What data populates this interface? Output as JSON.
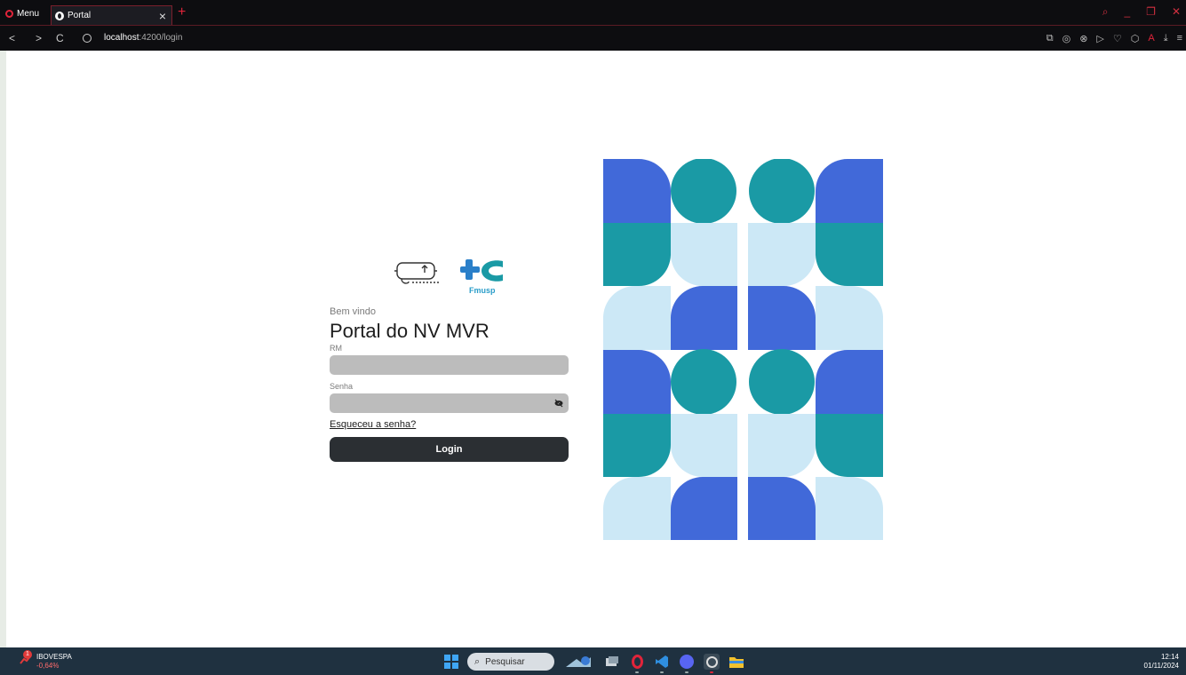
{
  "browser": {
    "menu_label": "Menu",
    "tab_title": "Portal",
    "url_host": "localhost",
    "url_path": ":4200/login",
    "accent_color": "#e0243a"
  },
  "brand": {
    "logo_text": "Fmusp",
    "logo_color": "#2a7fc9"
  },
  "login": {
    "welcome": "Bem vindo",
    "title": "Portal do NV MVR",
    "rm_label": "RM",
    "rm_value": "",
    "password_label": "Senha",
    "password_value": "",
    "forgot_link": "Esqueceu a senha?",
    "submit_label": "Login"
  },
  "mosaic": {
    "colors": {
      "blue": "#4169d9",
      "teal": "#1a9aa5",
      "light": "#cce8f6"
    }
  },
  "taskbar": {
    "stock_name": "IBOVESPA",
    "stock_change": "-0,64%",
    "stock_badge": "1",
    "search_placeholder": "Pesquisar",
    "time": "12:14",
    "date": "01/11/2024"
  }
}
